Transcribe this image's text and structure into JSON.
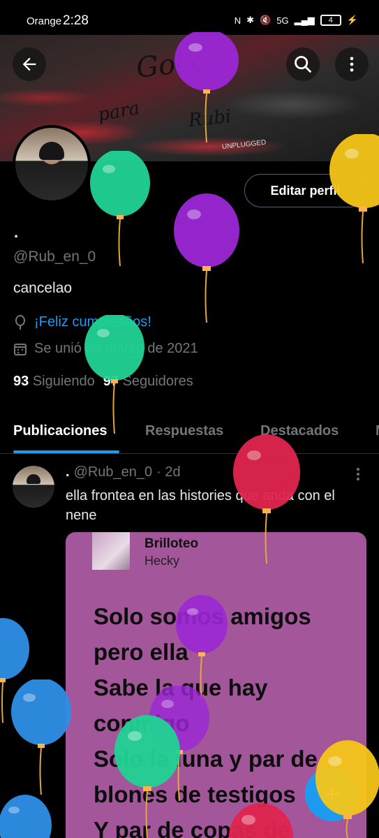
{
  "status_bar": {
    "carrier": "Orange",
    "time": "2:28",
    "network": "5G",
    "battery": "4"
  },
  "banner": {
    "scrawl_top": "Gotx",
    "scrawl_left": "para",
    "scrawl_right": "Rubi",
    "stamp": "UNPLUGGED"
  },
  "profile": {
    "display_name": ".",
    "handle": "@Rub_en_0",
    "bio": "cancelao",
    "birthday": "¡Feliz cumpleaños!",
    "joined": "Se unió en marzo de 2021",
    "following_count": "93",
    "following_label": "Siguiendo",
    "followers_count": "97",
    "followers_label": "Seguidores",
    "edit_button": "Editar perfil"
  },
  "tabs": [
    {
      "label": "Publicaciones",
      "active": true
    },
    {
      "label": "Respuestas",
      "active": false
    },
    {
      "label": "Destacados",
      "active": false
    },
    {
      "label": "M",
      "active": false
    }
  ],
  "post": {
    "name": ".",
    "handle": "@Rub_en_0",
    "time": "· 2d",
    "text": "ella frontea en las histories que anda con el nene",
    "song_title": "Brilloteo",
    "song_artist": "Hecky",
    "lyrics": [
      "Solo somos amigos",
      "pero ella",
      "Sabe la que hay",
      "conmigo",
      "Solo la luna y par de",
      "blones de testigos",
      "Y par de copas de"
    ]
  },
  "colors": {
    "accent": "#1d9bf0",
    "card": "#a3579a",
    "balloon_purple": "#9b27d6",
    "balloon_green": "#21d394",
    "balloon_red": "#e0254f",
    "balloon_yellow": "#f5c518",
    "balloon_blue": "#2d8fe6"
  },
  "icons": {
    "back": "arrow-left-icon",
    "search": "search-icon",
    "more": "more-vertical-icon",
    "birthday": "balloon-icon",
    "calendar": "calendar-icon",
    "compose": "plus-icon"
  }
}
